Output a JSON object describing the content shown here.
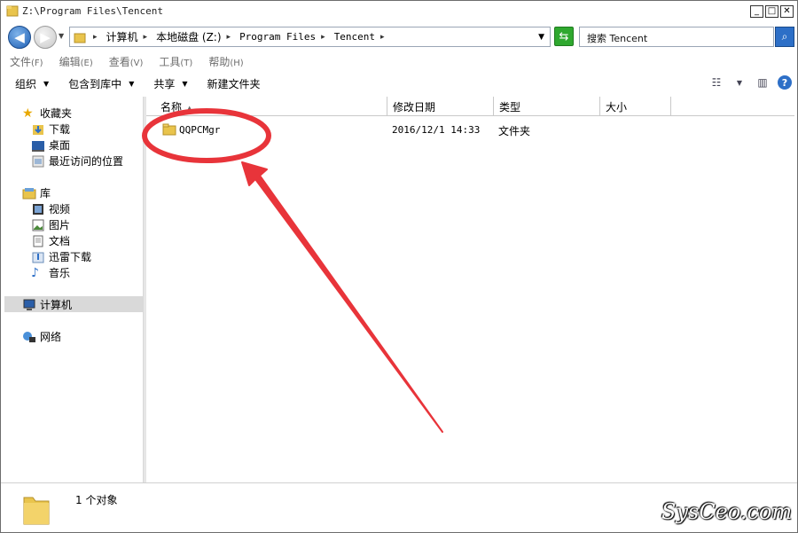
{
  "window": {
    "title": "Z:\\Program Files\\Tencent",
    "min_glyph": "_",
    "max_glyph": "□",
    "close_glyph": "✕"
  },
  "address": {
    "crumbs": [
      "计算机",
      "本地磁盘 (Z:)",
      "Program Files",
      "Tencent"
    ],
    "search_placeholder": "搜索 Tencent"
  },
  "menu": [
    {
      "label": "文件",
      "key": "(F)"
    },
    {
      "label": "编辑",
      "key": "(E)"
    },
    {
      "label": "查看",
      "key": "(V)"
    },
    {
      "label": "工具",
      "key": "(T)"
    },
    {
      "label": "帮助",
      "key": "(H)"
    }
  ],
  "toolbar": {
    "organize": "组织",
    "include_library": "包含到库中",
    "share": "共享",
    "new_folder": "新建文件夹"
  },
  "nav": {
    "favorites": "收藏夹",
    "downloads": "下载",
    "desktop": "桌面",
    "recent": "最近访问的位置",
    "libraries": "库",
    "videos": "视频",
    "pictures": "图片",
    "documents": "文档",
    "thunder": "迅雷下载",
    "music": "音乐",
    "computer": "计算机",
    "network": "网络"
  },
  "columns": {
    "name": "名称",
    "date": "修改日期",
    "type": "类型",
    "size": "大小"
  },
  "files": [
    {
      "name": "QQPCMgr",
      "date": "2016/12/1 14:33",
      "type": "文件夹",
      "size": ""
    }
  ],
  "status": {
    "count_text": "1 个对象"
  },
  "watermark": "SysCeo.com",
  "colors": {
    "annotation": "#e8343a",
    "selection": "#d9d9d9",
    "back_button": "#1d5fb4"
  },
  "icons": [
    "folder-icon",
    "back-icon",
    "forward-icon",
    "refresh-icon",
    "search-icon",
    "help-icon",
    "star-icon",
    "library-icon",
    "computer-icon",
    "network-icon"
  ]
}
